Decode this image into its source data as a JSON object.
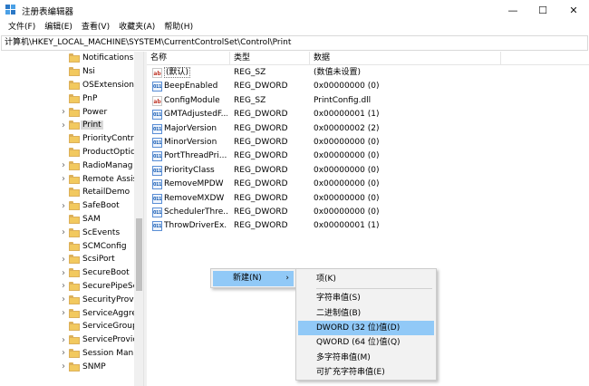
{
  "window": {
    "title": "注册表编辑器",
    "minimize": "—",
    "maximize": "☐",
    "close": "✕"
  },
  "menu": [
    "文件(F)",
    "编辑(E)",
    "查看(V)",
    "收藏夹(A)",
    "帮助(H)"
  ],
  "address": "计算机\\HKEY_LOCAL_MACHINE\\SYSTEM\\CurrentControlSet\\Control\\Print",
  "tree": {
    "selected": "Print",
    "items": [
      {
        "label": "Notifications",
        "expandable": false
      },
      {
        "label": "Nsi",
        "expandable": false
      },
      {
        "label": "OSExtensionD",
        "expandable": false
      },
      {
        "label": "PnP",
        "expandable": false
      },
      {
        "label": "Power",
        "expandable": true
      },
      {
        "label": "Print",
        "expandable": true
      },
      {
        "label": "PriorityContro",
        "expandable": false
      },
      {
        "label": "ProductOptic",
        "expandable": false
      },
      {
        "label": "RadioManag",
        "expandable": true
      },
      {
        "label": "Remote Assis",
        "expandable": true
      },
      {
        "label": "RetailDemo",
        "expandable": false
      },
      {
        "label": "SafeBoot",
        "expandable": true
      },
      {
        "label": "SAM",
        "expandable": false
      },
      {
        "label": "ScEvents",
        "expandable": true
      },
      {
        "label": "SCMConfig",
        "expandable": false
      },
      {
        "label": "ScsiPort",
        "expandable": true
      },
      {
        "label": "SecureBoot",
        "expandable": true
      },
      {
        "label": "SecurePipeSe",
        "expandable": true
      },
      {
        "label": "SecurityProvi",
        "expandable": true
      },
      {
        "label": "ServiceAggre",
        "expandable": true
      },
      {
        "label": "ServiceGroup",
        "expandable": false
      },
      {
        "label": "ServiceProvic",
        "expandable": true
      },
      {
        "label": "Session Man",
        "expandable": true
      },
      {
        "label": "SNMP",
        "expandable": true
      }
    ]
  },
  "list": {
    "headers": {
      "name": "名称",
      "type": "类型",
      "data": "数据"
    },
    "rows": [
      {
        "icon": "sz",
        "name": "(默认)",
        "type": "REG_SZ",
        "data": "(数值未设置)"
      },
      {
        "icon": "dw",
        "name": "BeepEnabled",
        "type": "REG_DWORD",
        "data": "0x00000000 (0)"
      },
      {
        "icon": "sz",
        "name": "ConfigModule",
        "type": "REG_SZ",
        "data": "PrintConfig.dll"
      },
      {
        "icon": "dw",
        "name": "GMTAdjustedF...",
        "type": "REG_DWORD",
        "data": "0x00000001 (1)"
      },
      {
        "icon": "dw",
        "name": "MajorVersion",
        "type": "REG_DWORD",
        "data": "0x00000002 (2)"
      },
      {
        "icon": "dw",
        "name": "MinorVersion",
        "type": "REG_DWORD",
        "data": "0x00000000 (0)"
      },
      {
        "icon": "dw",
        "name": "PortThreadPri...",
        "type": "REG_DWORD",
        "data": "0x00000000 (0)"
      },
      {
        "icon": "dw",
        "name": "PriorityClass",
        "type": "REG_DWORD",
        "data": "0x00000000 (0)"
      },
      {
        "icon": "dw",
        "name": "RemoveMPDW",
        "type": "REG_DWORD",
        "data": "0x00000000 (0)"
      },
      {
        "icon": "dw",
        "name": "RemoveMXDW",
        "type": "REG_DWORD",
        "data": "0x00000000 (0)"
      },
      {
        "icon": "dw",
        "name": "SchedulerThre...",
        "type": "REG_DWORD",
        "data": "0x00000000 (0)"
      },
      {
        "icon": "dw",
        "name": "ThrowDriverEx...",
        "type": "REG_DWORD",
        "data": "0x00000001 (1)"
      }
    ]
  },
  "context_menu": {
    "main_label": "新建(N)",
    "main_arrow": "›",
    "submenu": [
      {
        "label": "项(K)",
        "highlight": false
      },
      {
        "separator": true
      },
      {
        "label": "字符串值(S)",
        "highlight": false
      },
      {
        "label": "二进制值(B)",
        "highlight": false
      },
      {
        "label": "DWORD (32 位)值(D)",
        "highlight": true
      },
      {
        "label": "QWORD (64 位)值(Q)",
        "highlight": false
      },
      {
        "label": "多字符串值(M)",
        "highlight": false
      },
      {
        "label": "可扩充字符串值(E)",
        "highlight": false
      }
    ]
  },
  "colors": {
    "highlight": "#91c9f7",
    "folder": "#f2c95f",
    "selected_tree": "#d9d9d9"
  }
}
